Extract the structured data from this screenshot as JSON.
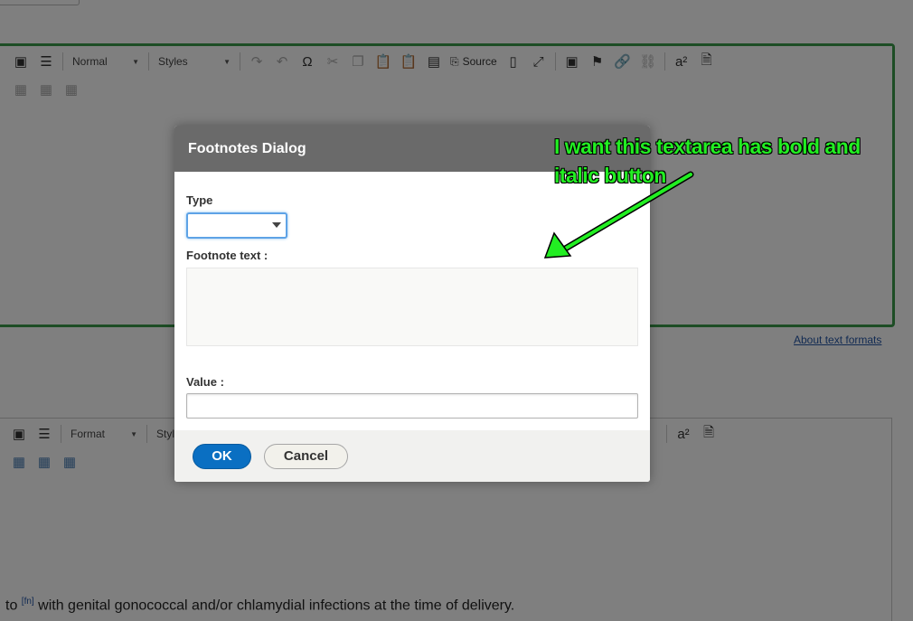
{
  "editor1": {
    "toolbar_row1": [
      {
        "icon": "image-icon",
        "glyph": "🖼"
      },
      {
        "icon": "horizontal-rule-icon",
        "glyph": "≡"
      }
    ],
    "format_combo": "Normal",
    "styles_combo": "Styles",
    "source_label": "Source"
  },
  "about_text_formats": "About text formats",
  "editor2": {
    "format_combo": "Format",
    "styles_combo": "Styl"
  },
  "body_text": {
    "before": "to ",
    "footnote_ref": "[fn]",
    "after": " with genital gonococcal and/or chlamydial infections at the time of delivery."
  },
  "dialog": {
    "title": "Footnotes Dialog",
    "type_label": "Type",
    "type_value": "",
    "footnote_text_label": "Footnote text :",
    "footnote_text_value": "",
    "value_label": "Value :",
    "value_value": "",
    "ok_label": "OK",
    "cancel_label": "Cancel"
  },
  "annotation": {
    "line1": "I want this textarea has bold and",
    "line2": "italic button",
    "color": "#22ee22"
  }
}
